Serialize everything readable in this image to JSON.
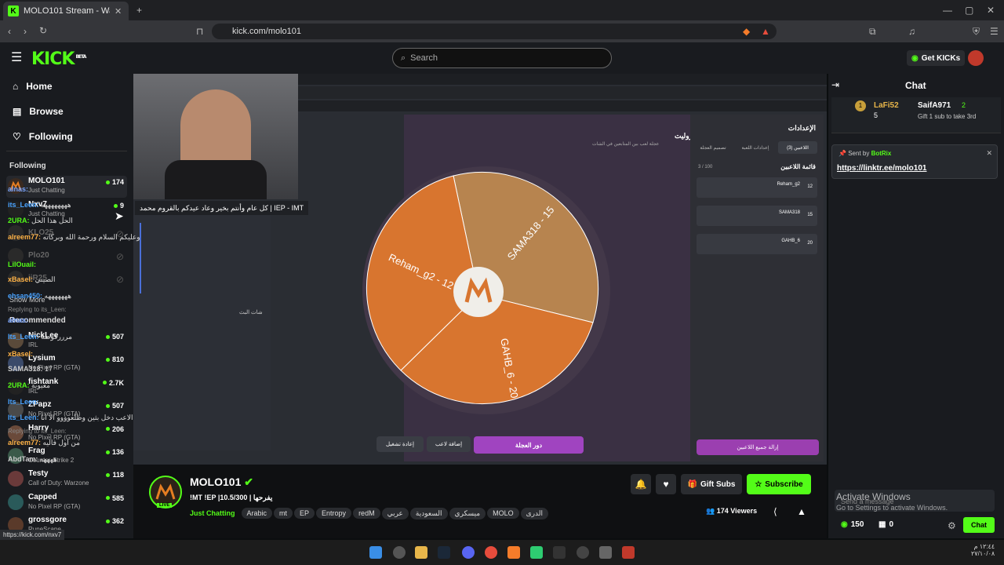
{
  "browser": {
    "tab_title": "MOLO101 Stream - Watch Li",
    "url": "kick.com/molo101",
    "status_url": "https://kick.com/nxv7"
  },
  "header": {
    "logo": "KICK",
    "beta": "BETA",
    "search_placeholder": "Search",
    "get_kicks": "Get KICKs"
  },
  "sidebar": {
    "nav": [
      "Home",
      "Browse",
      "Following"
    ],
    "following_title": "Following",
    "following": [
      {
        "name": "MOLO101",
        "category": "Just Chatting",
        "viewers": "174"
      },
      {
        "name": "Nxv7",
        "category": "Just Chatting",
        "viewers": "9"
      },
      {
        "name": "KLO25",
        "category": "",
        "viewers": ""
      },
      {
        "name": "Plo20",
        "category": "",
        "viewers": ""
      },
      {
        "name": "iiR25",
        "category": "",
        "viewers": ""
      }
    ],
    "show_more": "Show More",
    "recommended_title": "Recommended",
    "recommended": [
      {
        "name": "NickLee",
        "category": "IRL",
        "viewers": "507"
      },
      {
        "name": "Lysium",
        "category": "No Pixel RP (GTA)",
        "viewers": "810"
      },
      {
        "name": "fishtank",
        "category": "IRL",
        "viewers": "2.7K"
      },
      {
        "name": "ZPapz",
        "category": "No Pixel RP (GTA)",
        "viewers": "507"
      },
      {
        "name": "Harry",
        "category": "No Pixel RP (GTA)",
        "viewers": "206"
      },
      {
        "name": "Frag",
        "category": "Counter-Strike 2",
        "viewers": "136"
      },
      {
        "name": "Testy",
        "category": "Call of Duty: Warzone",
        "viewers": "118"
      },
      {
        "name": "Capped",
        "category": "No Pixel RP (GTA)",
        "viewers": "585"
      },
      {
        "name": "grossgore",
        "category": "RuneScape",
        "viewers": "362"
      }
    ],
    "tooltip": "كل عام وأنتم بخير وعاد عيدكم بالقروم محمد | IEP - IMT"
  },
  "stream": {
    "roulette_title": "الروليت",
    "roulette_sub": "عجلة لعب بين المتابعين في الشات",
    "wheel_segments": [
      "SAMA318 - 15",
      "Reham_g2 - 12",
      "GAHB_6 - 20"
    ],
    "btn_spin": "دور العجلة",
    "btn_add": "إضافة لاعب",
    "btn_restart": "إعادة تشغيل",
    "settings_title": "الإعدادات",
    "tabs": [
      "اللاعبين (3)",
      "إعدادات اللعبة",
      "تصميم العجلة"
    ],
    "players_title": "قائمة اللاعبين",
    "players_count": "3 / 100",
    "players": [
      {
        "name": "Reham_g2",
        "num": "12"
      },
      {
        "name": "SAMA318",
        "num": "15"
      },
      {
        "name": "GAHB_6",
        "num": "20"
      }
    ],
    "remove_all": "إزالة جميع اللاعبين",
    "chat_title": "شات البث"
  },
  "chat": {
    "title": "Chat",
    "top_gifters": [
      {
        "name": "LaFi52",
        "count": "5"
      },
      {
        "name": "SaifA971",
        "count": "2"
      }
    ],
    "gift_text": "Gift 1 sub to take 3rd",
    "pinned_by": "Sent by",
    "pinned_user": "BotRix",
    "pinned_link": "https://linktr.ee/molo101",
    "messages": [
      {
        "user": "alnas:",
        "text": "",
        "color": "#7aa6ff"
      },
      {
        "user": "its_Leen:",
        "text": "ههههههههه",
        "color": "#4aa3ff"
      },
      {
        "user": "2URA:",
        "text": "الحل هذا الحل",
        "color": "#53fc18"
      },
      {
        "user": "alreem77:",
        "text": "وعليكم السلام ورحمة الله وبركاته",
        "color": "#ffb347"
      },
      {
        "user": "LilOuail:",
        "text": "",
        "color": "#53fc18"
      },
      {
        "user": "xBasel:",
        "text": "الصيني",
        "color": "#ffb347"
      },
      {
        "user": "ehsan450:",
        "text": "هههههههه",
        "color": "#4aa3ff"
      },
      {
        "user": "alnas:",
        "text": "",
        "color": "#7aa6ff"
      },
      {
        "user": "Its_Leen:",
        "text": "مرررفوضة",
        "color": "#4aa3ff"
      },
      {
        "user": "xBasel:",
        "text": "",
        "color": "#ffb347"
      },
      {
        "user": "SAMA318:",
        "text": "17",
        "color": "#cccccc"
      },
      {
        "user": "2URA:",
        "text": "معيوبة",
        "color": "#53fc18"
      },
      {
        "user": "Its_Leen:",
        "text": "",
        "color": "#4aa3ff"
      },
      {
        "user": "Its_Leen:",
        "text": "الاعب دخل بثين وطلعوووو الا انا",
        "color": "#4aa3ff"
      },
      {
        "user": "alreem77:",
        "text": "من اول فاليه",
        "color": "#ffb347"
      },
      {
        "user": "AbdTam:",
        "text": "ههههه",
        "color": "#cccccc"
      }
    ],
    "reply1": "Replying to its_Leen:",
    "reply2": "Replying to its_Leen:",
    "send_placeholder": "Send a message",
    "kicks": "150",
    "points": "0",
    "chat_button": "Chat"
  },
  "info": {
    "channel": "MOLO101",
    "live": "LIVE",
    "title": "!MT !EP |10.5/300 | يفرحها",
    "category": "Just Chatting",
    "tags": [
      "Arabic",
      "mt",
      "EP",
      "Entropy",
      "redM",
      "عربي",
      "السعودية",
      "ميسكري",
      "MOLO",
      "الدرى"
    ],
    "gift_subs": "Gift Subs",
    "subscribe": "Subscribe",
    "viewers": "174 Viewers"
  },
  "windows": {
    "activate_title": "Activate Windows",
    "activate_sub": "Go to Settings to activate Windows.",
    "time": "١٢:٤٤ م",
    "date": "٢٧/١٠/٠٨"
  }
}
